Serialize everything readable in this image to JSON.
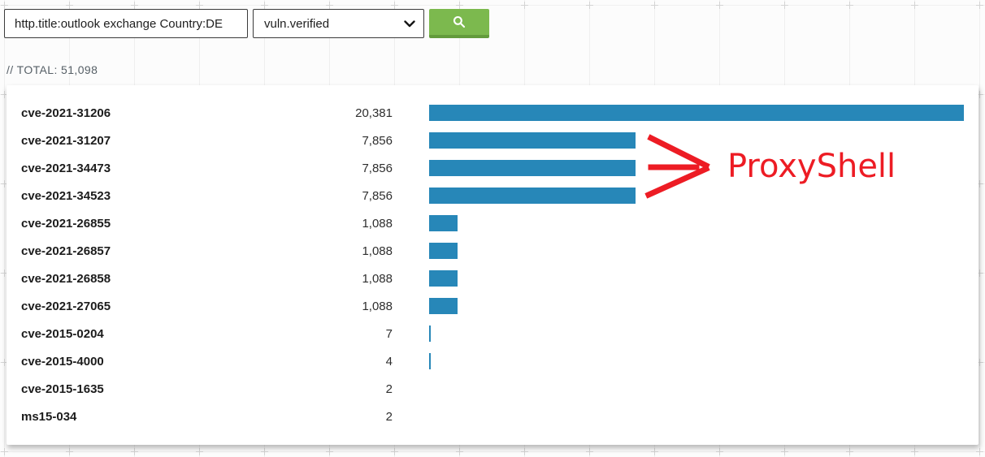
{
  "toolbar": {
    "query_value": "http.title:outlook exchange Country:DE",
    "facet_selected": "vuln.verified",
    "search_button_color": "#7cb94e",
    "search_icon": "magnifier-icon"
  },
  "summary": {
    "total_label": "// TOTAL:",
    "total_value": "51,098"
  },
  "chart_data": {
    "type": "bar",
    "orientation": "horizontal",
    "categories": [
      "cve-2021-31206",
      "cve-2021-31207",
      "cve-2021-34473",
      "cve-2021-34523",
      "cve-2021-26855",
      "cve-2021-26857",
      "cve-2021-26858",
      "cve-2021-27065",
      "cve-2015-0204",
      "cve-2015-4000",
      "cve-2015-1635",
      "ms15-034"
    ],
    "values": [
      20381,
      7856,
      7856,
      7856,
      1088,
      1088,
      1088,
      1088,
      7,
      4,
      2,
      2
    ],
    "value_labels": [
      "20,381",
      "7,856",
      "7,856",
      "7,856",
      "1,088",
      "1,088",
      "1,088",
      "1,088",
      "7",
      "4",
      "2",
      "2"
    ],
    "bar_color": "#2787b8",
    "xlim": [
      0,
      20381
    ],
    "title": "",
    "xlabel": "",
    "ylabel": ""
  },
  "annotation": {
    "text": "ProxyShell",
    "color": "#ed1c24",
    "icon": "right-arrow-icon"
  }
}
